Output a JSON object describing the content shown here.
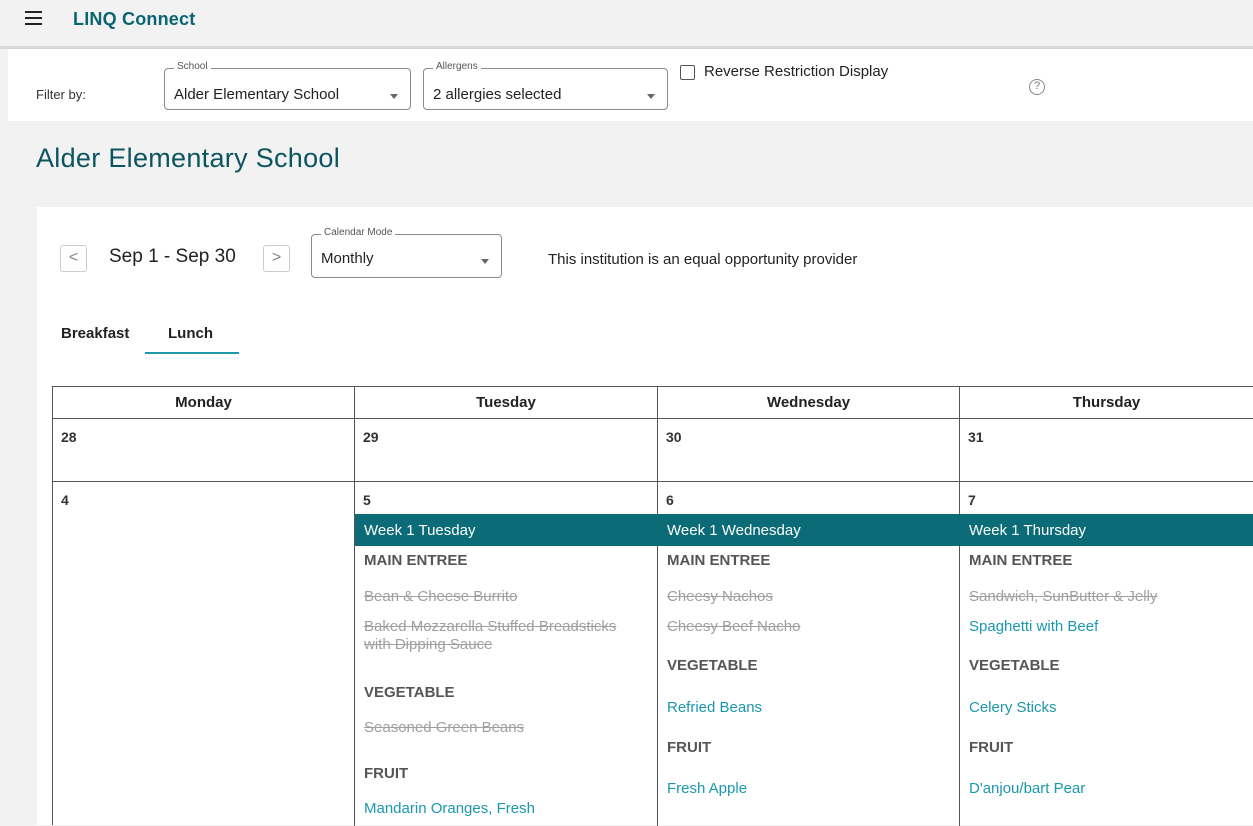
{
  "app": {
    "brand": "LINQ Connect"
  },
  "filters": {
    "label": "Filter by:",
    "school": {
      "legend": "School",
      "value": "Alder Elementary School"
    },
    "allergens": {
      "legend": "Allergens",
      "value": "2 allergies selected"
    },
    "reverse_label": "Reverse Restriction Display",
    "help": "?"
  },
  "page": {
    "title": "Alder Elementary School"
  },
  "calendar": {
    "prev": "<",
    "next": ">",
    "range": "Sep 1 - Sep 30",
    "mode": {
      "legend": "Calendar Mode",
      "value": "Monthly"
    },
    "notice": "This institution is an equal opportunity provider",
    "tabs": [
      "Breakfast",
      "Lunch"
    ],
    "active_tab": "Lunch",
    "headers": [
      "Monday",
      "Tuesday",
      "Wednesday",
      "Thursday"
    ],
    "week0": [
      "28",
      "29",
      "30",
      "31"
    ],
    "week1": {
      "days": [
        "4",
        "5",
        "6",
        "7"
      ],
      "tuesday": {
        "label": "Week 1 Tuesday",
        "main_entree": "MAIN ENTREE",
        "entree1": "Bean & Cheese Burrito",
        "entree2": "Baked Mozzarella Stuffed Breadsticks",
        "entree2b": "with Dipping Sauce",
        "vegetable": "VEGETABLE",
        "veg1": "Seasoned Green Beans",
        "fruit": "FRUIT",
        "fruit1": "Mandarin Oranges, Fresh"
      },
      "wednesday": {
        "label": "Week 1 Wednesday",
        "main_entree": "MAIN ENTREE",
        "entree1": "Cheesy Nachos",
        "entree2": "Cheesy Beef Nacho",
        "vegetable": "VEGETABLE",
        "veg1": "Refried Beans",
        "fruit": "FRUIT",
        "fruit1": "Fresh Apple"
      },
      "thursday": {
        "label": "Week 1 Thursday",
        "main_entree": "MAIN ENTREE",
        "entree1": "Sandwich, SunButter & Jelly",
        "entree2": "Spaghetti with Beef",
        "vegetable": "VEGETABLE",
        "veg1": "Celery Sticks",
        "fruit": "FRUIT",
        "fruit1": "D'anjou/bart Pear"
      }
    }
  },
  "colors": {
    "brand": "#0b6472",
    "week_bar": "#0b6b76",
    "available_item": "#1a98ad",
    "restricted_item": "#a0a0a0"
  }
}
